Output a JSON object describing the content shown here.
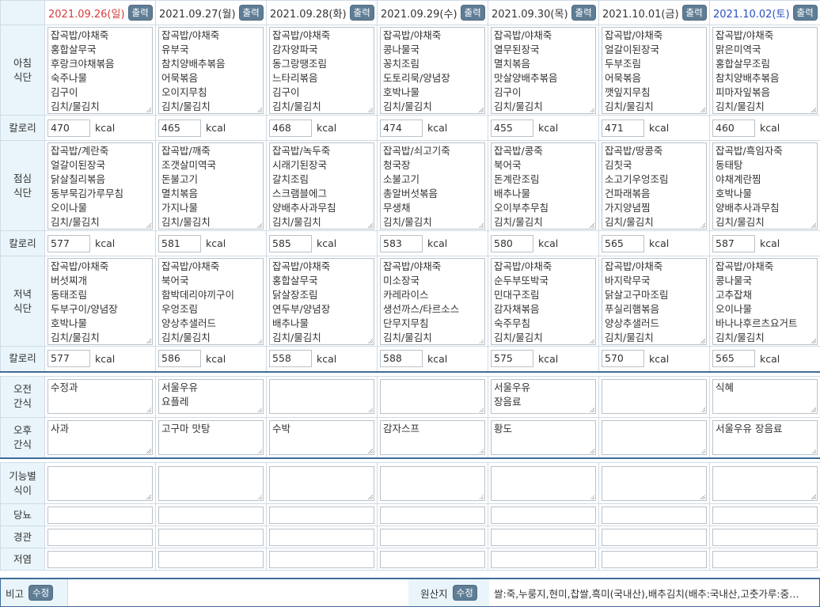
{
  "print_label": "출력",
  "edit_label": "수정",
  "kcal_unit": "kcal",
  "labels": {
    "breakfast": "아침\n식단",
    "lunch": "점심\n식단",
    "dinner": "저녁\n식단",
    "calorie": "칼로리",
    "am_snack": "오전\n간식",
    "pm_snack": "오후\n간식",
    "functional": "기능별\n식이",
    "diabetes": "당뇨",
    "tube": "경관",
    "low_salt": "저염",
    "note": "비고",
    "origin": "원산지"
  },
  "origin_text": "쌀:죽,누룽지,현미,찹쌀,흑미(국내산),배추김치(배추:국내산,고춧가루:중…",
  "days": [
    {
      "date": "2021.09.26(일)",
      "type": "sun",
      "breakfast": "잡곡밥/야채죽\n홍합살무국\n후랑크야채볶음\n숙주나물\n김구이\n김치/물김치",
      "breakfast_kcal": "470",
      "lunch": "잡곡밥/계란죽\n얼갈이된장국\n닭살칠리볶음\n동부묵김가루무침\n오이나물\n김치/물김치",
      "lunch_kcal": "577",
      "dinner": "잡곡밥/야채죽\n버섯찌개\n동태조림\n두부구이/양념장\n호박나물\n김치/물김치",
      "dinner_kcal": "577",
      "am_snack": "수정과",
      "pm_snack": "사과"
    },
    {
      "date": "2021.09.27(월)",
      "type": "",
      "breakfast": "잡곡밥/야채죽\n유부국\n참치양배추볶음\n어묵볶음\n오이지무침\n김치/물김치",
      "breakfast_kcal": "465",
      "lunch": "잡곡밥/깨죽\n조갯살미역국\n돈불고기\n멸치볶음\n가지나물\n김치/물김치",
      "lunch_kcal": "581",
      "dinner": "잡곡밥/야채죽\n북어국\n함박데리야끼구이\n우엉조림\n양상추샐러드\n김치/물김치",
      "dinner_kcal": "586",
      "am_snack": "서울우유\n요플레",
      "pm_snack": "고구마 맛탕"
    },
    {
      "date": "2021.09.28(화)",
      "type": "",
      "breakfast": "잡곡밥/야채죽\n감자양파국\n동그랑땡조림\n느타리볶음\n김구이\n김치/물김치",
      "breakfast_kcal": "468",
      "lunch": "잡곡밥/녹두죽\n시래기된장국\n갈치조림\n스크램블에그\n양배추사과무침\n김치/물김치",
      "lunch_kcal": "585",
      "dinner": "잡곡밥/야채죽\n홍합살무국\n닭살장조림\n연두부/양념장\n배추나물\n김치/물김치",
      "dinner_kcal": "558",
      "am_snack": "",
      "pm_snack": "수박"
    },
    {
      "date": "2021.09.29(수)",
      "type": "",
      "breakfast": "잡곡밥/야채죽\n콩나물국\n꽁치조림\n도토리묵/양념장\n호박나물\n김치/물김치",
      "breakfast_kcal": "474",
      "lunch": "잡곡밥/쇠고기죽\n청국장\n소불고기\n총알버섯볶음\n무생채\n김치/물김치",
      "lunch_kcal": "583",
      "dinner": "잡곡밥/야채죽\n미소장국\n카레라이스\n생선까스/타르소스\n단무지무침\n김치/물김치",
      "dinner_kcal": "588",
      "am_snack": "",
      "pm_snack": "감자스프"
    },
    {
      "date": "2021.09.30(목)",
      "type": "",
      "breakfast": "잡곡밥/야채죽\n열무된장국\n멸치볶음\n맛살양배추볶음\n김구이\n김치/물김치",
      "breakfast_kcal": "455",
      "lunch": "잡곡밥/콩죽\n북어국\n돈계란조림\n배추나물\n오이부추무침\n김치/물김치",
      "lunch_kcal": "580",
      "dinner": "잡곡밥/야채죽\n순두부또박국\n민대구조림\n감자채볶음\n숙주무침\n김치/물김치",
      "dinner_kcal": "575",
      "am_snack": "서울우유\n장음료",
      "pm_snack": "황도"
    },
    {
      "date": "2021.10.01(금)",
      "type": "",
      "breakfast": "잡곡밥/야채죽\n얼갈이된장국\n두부조림\n어묵볶음\n깻잎지무침\n김치/물김치",
      "breakfast_kcal": "471",
      "lunch": "잡곡밥/땅콩죽\n김칫국\n소고기우엉조림\n건파래볶음\n가지양념찜\n김치/물김치",
      "lunch_kcal": "565",
      "dinner": "잡곡밥/야채죽\n바지락무국\n닭살고구마조림\n푸실리햄볶음\n양상추샐러드\n김치/물김치",
      "dinner_kcal": "570",
      "am_snack": "",
      "pm_snack": ""
    },
    {
      "date": "2021.10.02(토)",
      "type": "sat",
      "breakfast": "잡곡밥/야채죽\n맑은미역국\n홍합살무조림\n참치양배추볶음\n피마자잎볶음\n김치/물김치",
      "breakfast_kcal": "460",
      "lunch": "잡곡밥/흑임자죽\n동태탕\n야채계란찜\n호박나물\n양배추사과무침\n김치/물김치",
      "lunch_kcal": "587",
      "dinner": "잡곡밥/야채죽\n콩나물국\n고추잡채\n오이나물\n바나나후르츠요거트\n김치/물김치",
      "dinner_kcal": "565",
      "am_snack": "식혜",
      "pm_snack": "서울우유 장음료"
    }
  ]
}
